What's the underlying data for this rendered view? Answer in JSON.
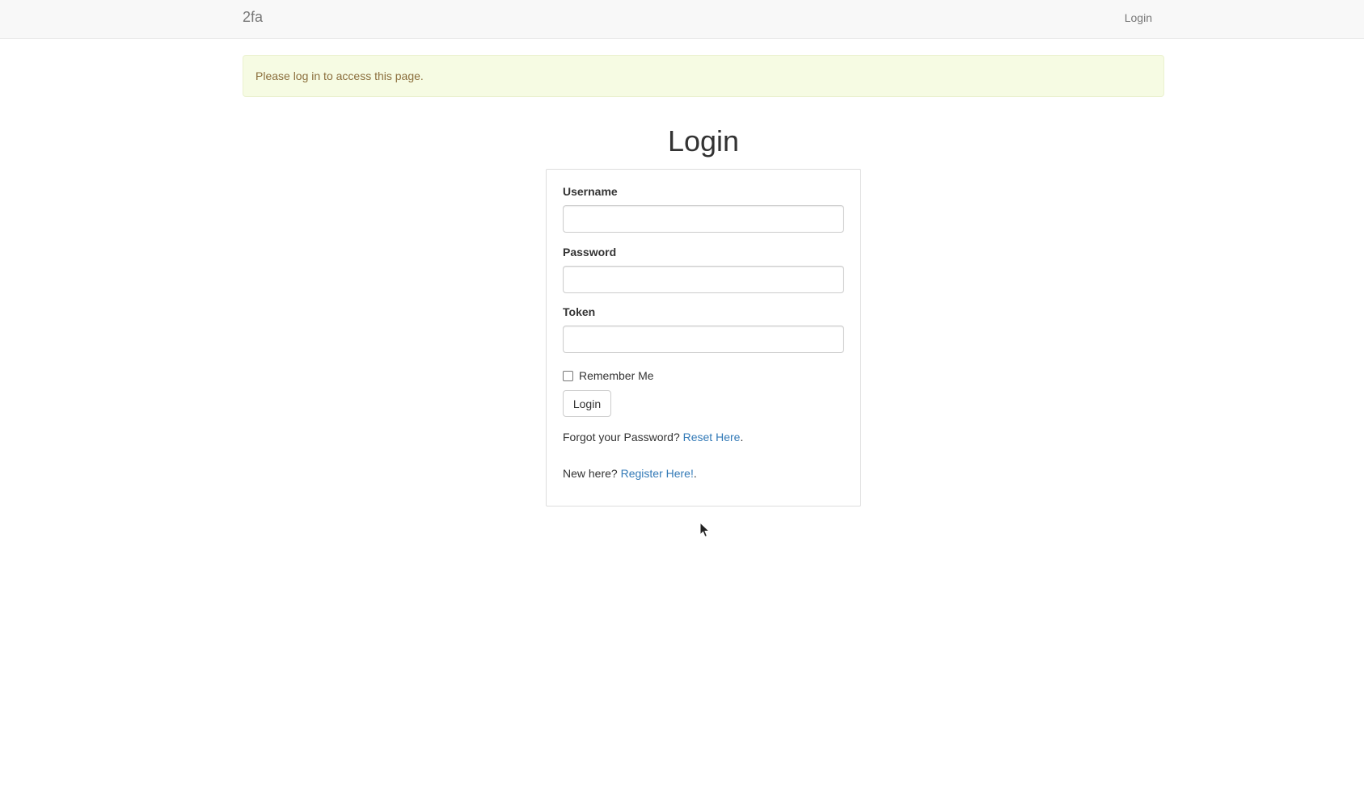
{
  "navbar": {
    "brand": "2fa",
    "login_link": "Login"
  },
  "alert": {
    "message": "Please log in to access this page."
  },
  "page": {
    "title": "Login"
  },
  "form": {
    "username_label": "Username",
    "username_value": "",
    "password_label": "Password",
    "password_value": "",
    "token_label": "Token",
    "token_value": "",
    "remember_label": "Remember Me",
    "remember_checked": false,
    "submit_label": "Login",
    "forgot_prefix": "Forgot your Password?",
    "forgot_link": "Reset Here",
    "forgot_suffix": ".",
    "register_prefix": "New here?",
    "register_link": "Register Here!",
    "register_suffix": "."
  },
  "colors": {
    "navbar_bg": "#f8f8f8",
    "alert_bg": "#f6fbe3",
    "alert_text": "#8a6d3b",
    "link": "#337ab7"
  },
  "icons": {
    "cursor": "mouse-pointer-icon"
  }
}
